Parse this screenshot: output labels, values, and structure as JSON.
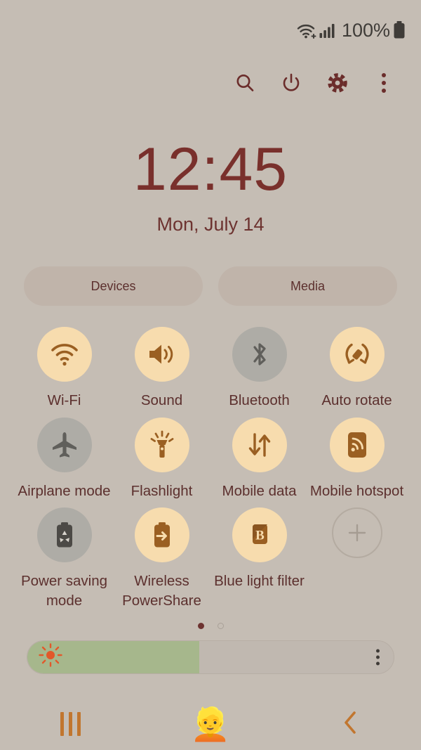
{
  "statusbar": {
    "wifi_icon": "wifi-plus-icon",
    "signal_icon": "cellular-signal-icon",
    "battery_percent": "100%",
    "battery_icon": "battery-full-icon"
  },
  "toolbar": {
    "items": [
      {
        "name": "search-icon",
        "label": "Search"
      },
      {
        "name": "power-icon",
        "label": "Power"
      },
      {
        "name": "settings-gear-icon",
        "label": "Settings"
      },
      {
        "name": "overflow-menu-icon",
        "label": "More options"
      }
    ]
  },
  "clock": {
    "time": "12:45",
    "date": "Mon, July 14"
  },
  "pills": [
    {
      "label": "Devices"
    },
    {
      "label": "Media"
    }
  ],
  "tiles": [
    {
      "label": "Wi-Fi",
      "icon": "wifi-icon",
      "state": "on"
    },
    {
      "label": "Sound",
      "icon": "sound-icon",
      "state": "on"
    },
    {
      "label": "Bluetooth",
      "icon": "bluetooth-icon",
      "state": "off"
    },
    {
      "label": "Auto rotate",
      "icon": "auto-rotate-icon",
      "state": "on"
    },
    {
      "label": "Airplane mode",
      "icon": "airplane-icon",
      "state": "off"
    },
    {
      "label": "Flashlight",
      "icon": "flashlight-icon",
      "state": "on"
    },
    {
      "label": "Mobile data",
      "icon": "mobile-data-icon",
      "state": "on"
    },
    {
      "label": "Mobile hotspot",
      "icon": "mobile-hotspot-icon",
      "state": "on"
    },
    {
      "label": "Power saving mode",
      "icon": "power-saving-icon",
      "state": "off"
    },
    {
      "label": "Wireless PowerShare",
      "icon": "wireless-powershare-icon",
      "state": "on"
    },
    {
      "label": "Blue light filter",
      "icon": "blue-light-filter-icon",
      "state": "on"
    },
    {
      "label": "",
      "icon": "add-button-icon",
      "state": "add"
    }
  ],
  "pages": {
    "total": 2,
    "current": 1
  },
  "brightness": {
    "value_percent": 47,
    "sun_icon": "brightness-sun-icon",
    "menu_icon": "brightness-options-icon"
  },
  "navbar": {
    "recents_label": "Recents",
    "home_icon": "woman-with-hat-emoji",
    "back_label": "Back"
  },
  "colors": {
    "background": "#c5bdb4",
    "accent_on": "#f7dcae",
    "accent_off": "#aeaca6",
    "icon_brown": "#9a5f22",
    "text_maroon": "#5c302e",
    "clock_maroon": "#79302c",
    "slider_green": "#a6b78c",
    "sun_orange": "#e2582a",
    "nav_orange": "#c1762f"
  }
}
